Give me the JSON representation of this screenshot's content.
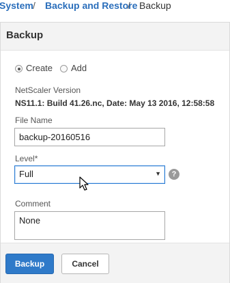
{
  "breadcrumb": {
    "items": [
      "System",
      "Backup and Restore",
      "Backup"
    ],
    "separator": "/"
  },
  "panel": {
    "title": "Backup"
  },
  "form": {
    "mode_options": [
      "Create",
      "Add"
    ],
    "mode_selected": "Create",
    "version_label": "NetScaler Version",
    "version_value": "NS11.1: Build 41.26.nc, Date: May 13 2016, 12:58:58",
    "filename_label": "File Name",
    "filename_value": "backup-20160516",
    "level_label": "Level*",
    "level_value": "Full",
    "level_arrow": "▼",
    "help_glyph": "?",
    "comment_label": "Comment",
    "comment_value": "None"
  },
  "footer": {
    "primary_label": "Backup",
    "cancel_label": "Cancel"
  },
  "colors": {
    "link": "#2a6ebb",
    "primary_button": "#2f7ac9",
    "panel_header": "#f3f3f3",
    "focus_border": "#2a7bd3"
  },
  "icons": {
    "help": "help-icon",
    "select_arrow": "chevron-down-icon",
    "pointer": "mouse-cursor-icon"
  }
}
